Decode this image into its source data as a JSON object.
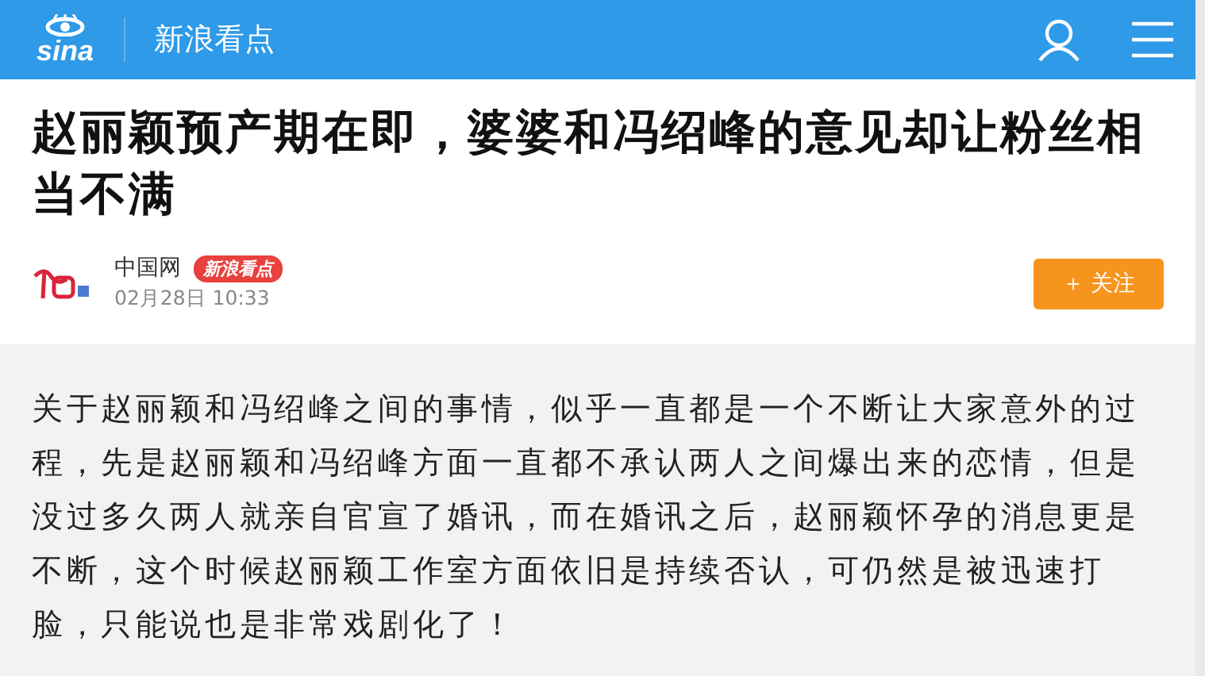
{
  "header": {
    "logo": "sina",
    "channel": "新浪看点"
  },
  "article": {
    "title": "赵丽颖预产期在即，婆婆和冯绍峰的意见却让粉丝相当不满",
    "source": "中国网",
    "badge": "新浪看点",
    "time": "02月28日  10:33",
    "follow_button": "＋ 关注"
  },
  "body": "关于赵丽颖和冯绍峰之间的事情，似乎一直都是一个不断让大家意外的过程，先是赵丽颖和冯绍峰方面一直都不承认两人之间爆出来的恋情，但是没过多久两人就亲自官宣了婚讯，而在婚讯之后，赵丽颖怀孕的消息更是不断，这个时候赵丽颖工作室方面依旧是持续否认，可仍然是被迅速打脸，只能说也是非常戏剧化了！"
}
